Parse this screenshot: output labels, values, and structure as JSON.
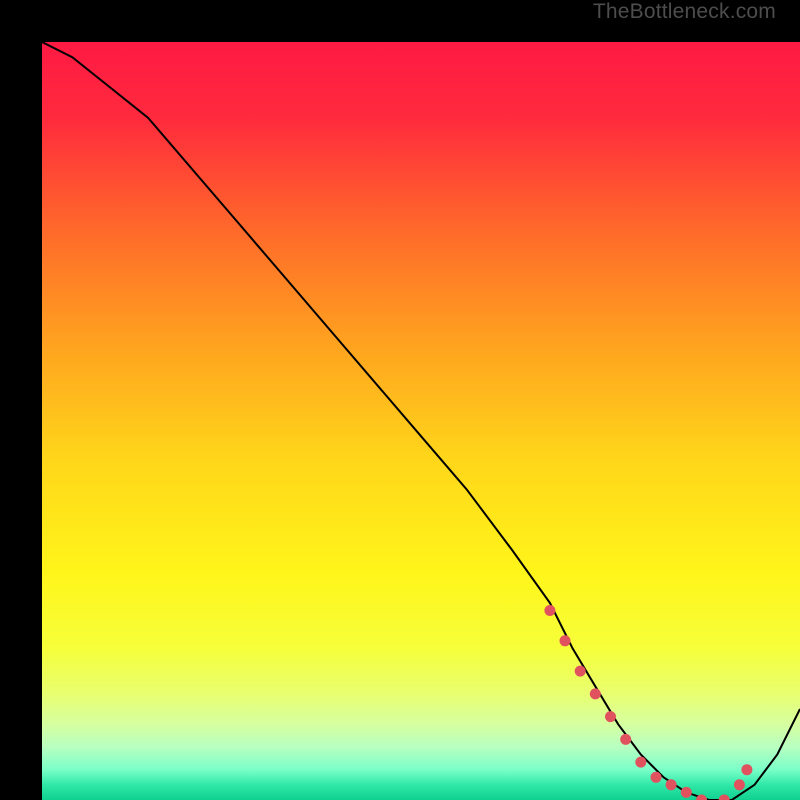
{
  "watermark": {
    "text": "TheBottleneck.com"
  },
  "chart_data": {
    "type": "line",
    "title": "",
    "xlabel": "",
    "ylabel": "",
    "xlim": [
      0,
      100
    ],
    "ylim": [
      0,
      100
    ],
    "grid": false,
    "background_gradient": {
      "direction": "vertical",
      "stops": [
        {
          "pos": 0.0,
          "color": "#ff1a44"
        },
        {
          "pos": 0.1,
          "color": "#ff2a3d"
        },
        {
          "pos": 0.25,
          "color": "#ff6a2a"
        },
        {
          "pos": 0.4,
          "color": "#ffa31f"
        },
        {
          "pos": 0.55,
          "color": "#ffd61a"
        },
        {
          "pos": 0.7,
          "color": "#fff51a"
        },
        {
          "pos": 0.8,
          "color": "#f6ff3a"
        },
        {
          "pos": 0.86,
          "color": "#e8ff70"
        },
        {
          "pos": 0.9,
          "color": "#d6ffa0"
        },
        {
          "pos": 0.93,
          "color": "#b8ffc0"
        },
        {
          "pos": 0.96,
          "color": "#7affc8"
        },
        {
          "pos": 0.98,
          "color": "#30e8a8"
        },
        {
          "pos": 1.0,
          "color": "#10d090"
        }
      ]
    },
    "series": [
      {
        "name": "bottleneck-curve",
        "color": "#000000",
        "x": [
          0,
          4,
          9,
          14,
          20,
          26,
          32,
          38,
          44,
          50,
          56,
          62,
          67,
          70,
          73,
          76,
          79,
          82,
          85,
          88,
          91,
          94,
          97,
          100
        ],
        "y": [
          100,
          98,
          94,
          90,
          83,
          76,
          69,
          62,
          55,
          48,
          41,
          33,
          26,
          20,
          15,
          10,
          6,
          3,
          1,
          0,
          0,
          2,
          6,
          12
        ]
      }
    ],
    "markers": {
      "color": "#e1525f",
      "x": [
        67,
        69,
        71,
        73,
        75,
        77,
        79,
        81,
        83,
        85,
        87,
        90,
        92,
        93
      ],
      "y": [
        25,
        21,
        17,
        14,
        11,
        8,
        5,
        3,
        2,
        1,
        0,
        0,
        2,
        4
      ]
    }
  }
}
